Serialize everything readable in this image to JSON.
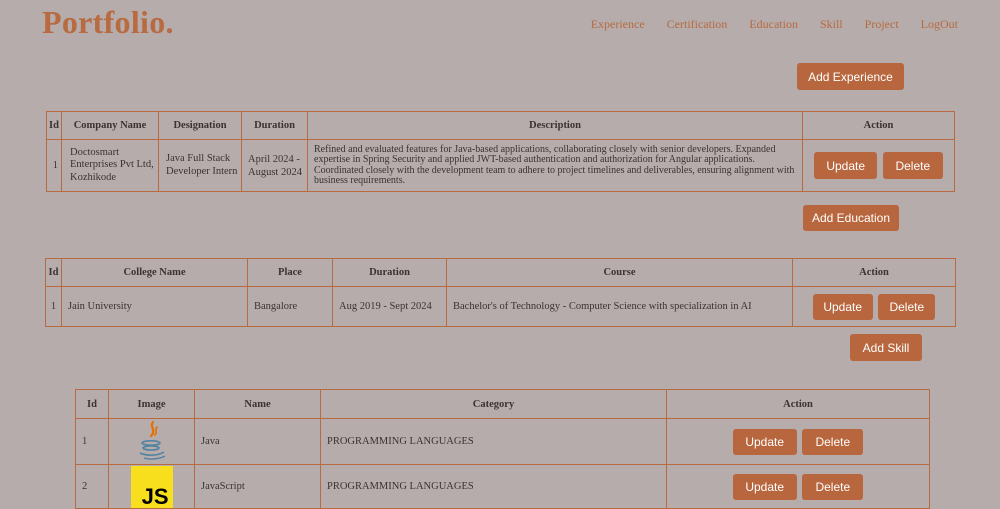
{
  "brand": "Portfolio.",
  "nav": [
    "Experience",
    "Certification",
    "Education",
    "Skill",
    "Project",
    "LogOut"
  ],
  "experience": {
    "add_label": "Add Experience",
    "headers": [
      "Id",
      "Company Name",
      "Designation",
      "Duration",
      "Description",
      "Action"
    ],
    "rows": [
      {
        "id": "1",
        "company": "Doctosmart Enterprises Pvt Ltd, Kozhikode",
        "designation": "Java Full Stack Developer Intern",
        "duration": "April 2024 - August 2024",
        "description": "Refined and evaluated features for Java-based applications, collaborating closely with senior developers. Expanded expertise in Spring Security and applied JWT-based authentication and authorization for Angular applications. Coordinated closely with the development team to adhere to project timelines and deliverables, ensuring alignment with business requirements.",
        "update": "Update",
        "delete": "Delete"
      }
    ]
  },
  "education": {
    "add_label": "Add Education",
    "headers": [
      "Id",
      "College Name",
      "Place",
      "Duration",
      "Course",
      "Action"
    ],
    "rows": [
      {
        "id": "1",
        "college": "Jain University",
        "place": "Bangalore",
        "duration": "Aug 2019 - Sept 2024",
        "course": "Bachelor's of Technology - Computer Science with specialization in AI",
        "update": "Update",
        "delete": "Delete"
      }
    ]
  },
  "skill": {
    "add_label": "Add Skill",
    "headers": [
      "Id",
      "Image",
      "Name",
      "Category",
      "Action"
    ],
    "rows": [
      {
        "id": "1",
        "icon": "java-logo-icon",
        "name": "Java",
        "category": "PROGRAMMING LANGUAGES",
        "update": "Update",
        "delete": "Delete"
      },
      {
        "id": "2",
        "icon": "javascript-logo-icon",
        "icon_text": "JS",
        "name": "JavaScript",
        "category": "PROGRAMMING LANGUAGES",
        "update": "Update",
        "delete": "Delete"
      }
    ]
  },
  "colors": {
    "background": "#b5acab",
    "accent": "#b8663d",
    "js_yellow": "#f7df1e"
  }
}
